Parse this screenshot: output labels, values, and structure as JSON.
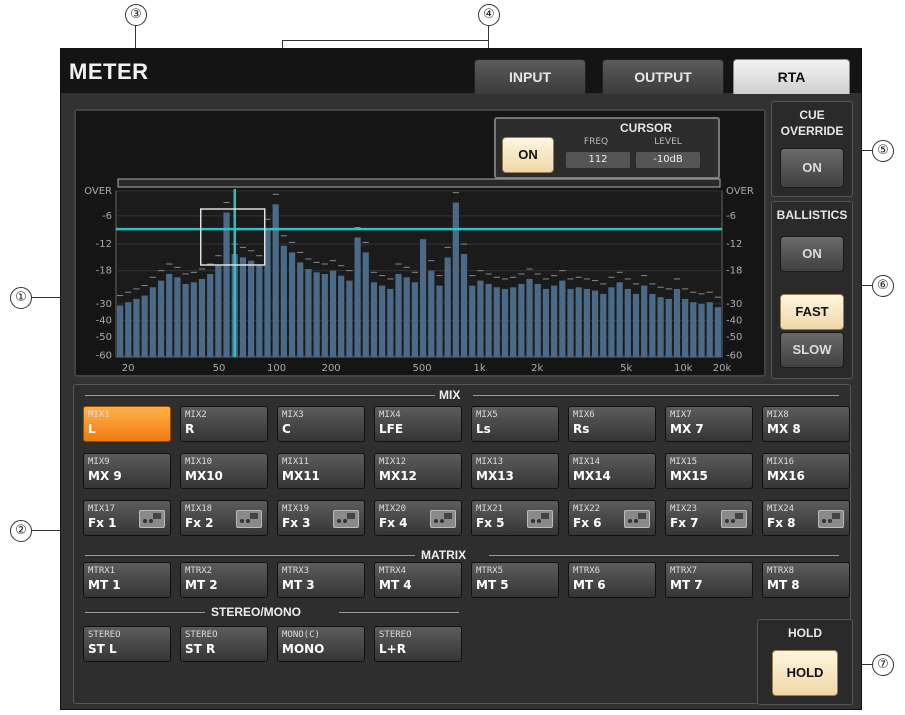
{
  "window": {
    "title": "METER"
  },
  "tabs": [
    {
      "label": "INPUT",
      "active": false
    },
    {
      "label": "OUTPUT",
      "active": false
    },
    {
      "label": "RTA",
      "active": true
    }
  ],
  "callouts": [
    "①",
    "②",
    "③",
    "④",
    "⑤",
    "⑥",
    "⑦"
  ],
  "cursor": {
    "title": "CURSOR",
    "on_label": "ON",
    "freq_label": "FREQ",
    "freq_value": "112",
    "level_label": "LEVEL",
    "level_value": "-10dB"
  },
  "cue_override": {
    "title_line1": "CUE",
    "title_line2": "OVERRIDE",
    "button": "ON"
  },
  "ballistics": {
    "title": "BALLISTICS",
    "on": "ON",
    "fast": "FAST",
    "slow": "SLOW"
  },
  "hold": {
    "title": "HOLD",
    "button": "HOLD"
  },
  "rta": {
    "y_ticks": [
      "OVER",
      "-6",
      "-12",
      "-18",
      "-30",
      "-40",
      "-50",
      "-60"
    ],
    "x_ticks": [
      "20",
      "50",
      "100",
      "200",
      "500",
      "1k",
      "2k",
      "5k",
      "10k",
      "20k"
    ],
    "bar_levels": [
      0.31,
      0.33,
      0.35,
      0.37,
      0.42,
      0.46,
      0.5,
      0.48,
      0.44,
      0.45,
      0.47,
      0.5,
      0.55,
      0.87,
      0.62,
      0.6,
      0.58,
      0.55,
      0.77,
      0.92,
      0.67,
      0.63,
      0.57,
      0.53,
      0.51,
      0.5,
      0.52,
      0.49,
      0.46,
      0.72,
      0.63,
      0.45,
      0.43,
      0.41,
      0.5,
      0.48,
      0.45,
      0.71,
      0.52,
      0.43,
      0.6,
      0.93,
      0.62,
      0.43,
      0.46,
      0.44,
      0.42,
      0.41,
      0.42,
      0.44,
      0.47,
      0.44,
      0.41,
      0.43,
      0.46,
      0.41,
      0.42,
      0.41,
      0.4,
      0.38,
      0.42,
      0.45,
      0.41,
      0.38,
      0.43,
      0.38,
      0.36,
      0.35,
      0.41,
      0.35,
      0.33,
      0.32,
      0.33,
      0.3
    ],
    "threshold_level": 0.77,
    "cursor_bar_index": 14
  },
  "sections": {
    "mix": "MIX",
    "matrix": "MATRIX",
    "stereo_mono": "STEREO/MONO"
  },
  "mix": [
    {
      "line1": "MIX1",
      "line2": "L",
      "selected": true
    },
    {
      "line1": "MIX2",
      "line2": "R"
    },
    {
      "line1": "MIX3",
      "line2": "C"
    },
    {
      "line1": "MIX4",
      "line2": "LFE"
    },
    {
      "line1": "MIX5",
      "line2": "Ls"
    },
    {
      "line1": "MIX6",
      "line2": "Rs"
    },
    {
      "line1": "MIX7",
      "line2": "MX 7"
    },
    {
      "line1": "MIX8",
      "line2": "MX 8"
    },
    {
      "line1": "MIX9",
      "line2": "MX 9"
    },
    {
      "line1": "MIX10",
      "line2": "MX10"
    },
    {
      "line1": "MIX11",
      "line2": "MX11"
    },
    {
      "line1": "MIX12",
      "line2": "MX12"
    },
    {
      "line1": "MIX13",
      "line2": "MX13"
    },
    {
      "line1": "MIX14",
      "line2": "MX14"
    },
    {
      "line1": "MIX15",
      "line2": "MX15"
    },
    {
      "line1": "MIX16",
      "line2": "MX16"
    },
    {
      "line1": "MIX17",
      "line2": "Fx 1",
      "fx": true
    },
    {
      "line1": "MIX18",
      "line2": "Fx 2",
      "fx": true
    },
    {
      "line1": "MIX19",
      "line2": "Fx 3",
      "fx": true
    },
    {
      "line1": "MIX20",
      "line2": "Fx 4",
      "fx": true
    },
    {
      "line1": "MIX21",
      "line2": "Fx 5",
      "fx": true
    },
    {
      "line1": "MIX22",
      "line2": "Fx 6",
      "fx": true
    },
    {
      "line1": "MIX23",
      "line2": "Fx 7",
      "fx": true
    },
    {
      "line1": "MIX24",
      "line2": "Fx 8",
      "fx": true
    }
  ],
  "matrix": [
    {
      "line1": "MTRX1",
      "line2": "MT 1"
    },
    {
      "line1": "MTRX2",
      "line2": "MT 2"
    },
    {
      "line1": "MTRX3",
      "line2": "MT 3"
    },
    {
      "line1": "MTRX4",
      "line2": "MT 4"
    },
    {
      "line1": "MTRX5",
      "line2": "MT 5"
    },
    {
      "line1": "MTRX6",
      "line2": "MT 6"
    },
    {
      "line1": "MTRX7",
      "line2": "MT 7"
    },
    {
      "line1": "MTRX8",
      "line2": "MT 8"
    }
  ],
  "stereo_mono": [
    {
      "line1": "STEREO",
      "line2": "ST L"
    },
    {
      "line1": "STEREO",
      "line2": "ST R"
    },
    {
      "line1": "MONO(C)",
      "line2": "MONO"
    },
    {
      "line1": "STEREO",
      "line2": "L+R"
    }
  ]
}
